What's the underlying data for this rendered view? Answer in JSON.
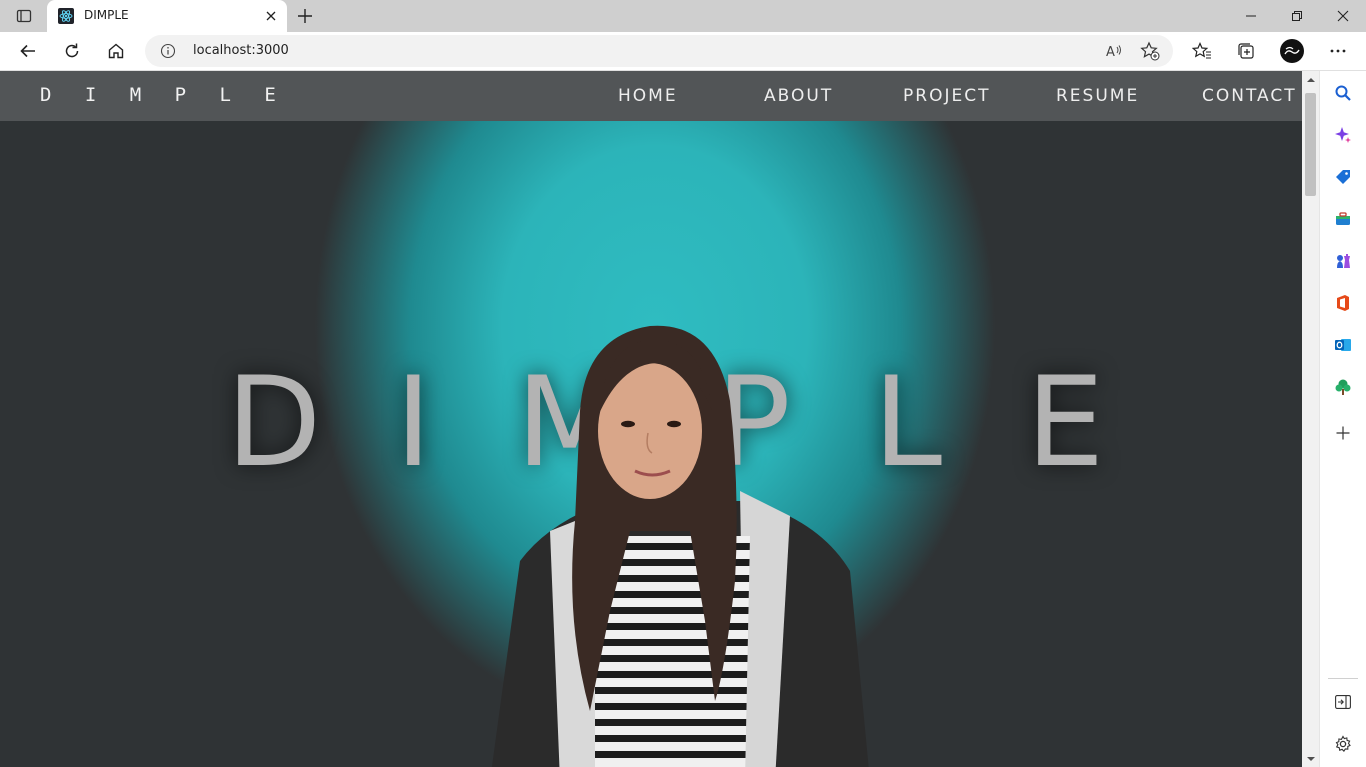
{
  "browser": {
    "tab": {
      "title": "DIMPLE"
    },
    "address": {
      "url": "localhost:3000"
    }
  },
  "site": {
    "brand": "D I M P L E",
    "nav": [
      {
        "label": "HOME"
      },
      {
        "label": "ABOUT"
      },
      {
        "label": "PROJECT"
      },
      {
        "label": "RESUME"
      },
      {
        "label": "CONTACT"
      }
    ],
    "hero_letters": [
      "D",
      "I",
      "M",
      "P",
      "L",
      "E"
    ]
  },
  "colors": {
    "accent_glow": "#2fbcc1",
    "page_background": "#2f3133",
    "navbar": "#525557",
    "hero_text": "#b3b3b3"
  },
  "icons": {
    "toolbar": [
      "back-icon",
      "refresh-icon",
      "home-icon",
      "info-icon",
      "read-aloud-icon",
      "add-favorite-icon",
      "favorites-icon",
      "collections-icon",
      "profile-avatar",
      "more-icon"
    ],
    "sidebar": [
      "search-icon",
      "copilot-icon",
      "shopping-icon",
      "tools-icon",
      "games-icon",
      "office-icon",
      "outlook-icon",
      "tree-icon",
      "add-icon",
      "hide-sidebar-icon",
      "settings-icon"
    ]
  }
}
